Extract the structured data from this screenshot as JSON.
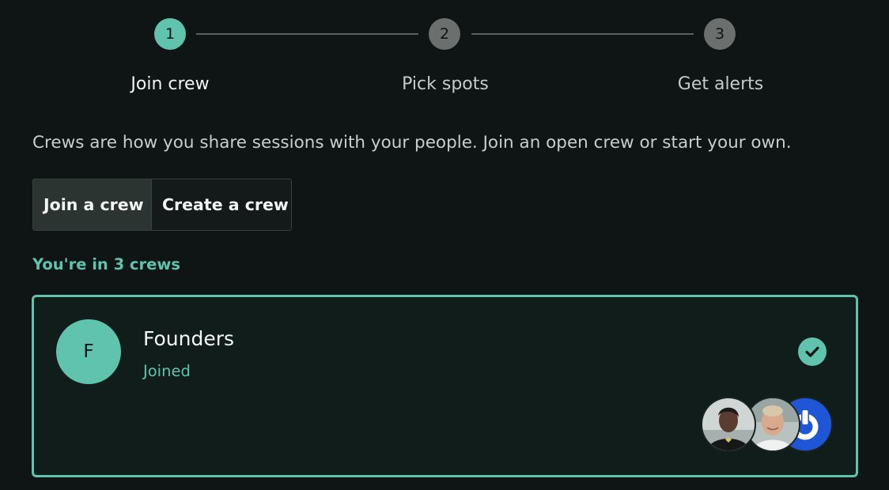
{
  "stepper": {
    "steps": [
      {
        "number": "1",
        "label": "Join crew",
        "state": "active"
      },
      {
        "number": "2",
        "label": "Pick spots",
        "state": "inactive"
      },
      {
        "number": "3",
        "label": "Get alerts",
        "state": "inactive"
      }
    ]
  },
  "intro_text": "Crews are how you share sessions with your people. Join an open crew or start your own.",
  "toggle": {
    "join_label": "Join a crew",
    "create_label": "Create a crew",
    "selected": "join"
  },
  "crew_count_label": "You're in 3 crews",
  "crews": [
    {
      "initial": "F",
      "name": "Founders",
      "status": "Joined",
      "selected": true,
      "members": [
        {
          "avatar": "photo-avatar"
        },
        {
          "avatar": "photo-avatar"
        },
        {
          "avatar": "power-logo-avatar"
        }
      ]
    }
  ],
  "colors": {
    "background": "#0f1514",
    "accent": "#5fc3ad",
    "card_background": "#111d1b",
    "inactive_step": "#6b6f6e",
    "logo_blue": "#1f56d6"
  }
}
